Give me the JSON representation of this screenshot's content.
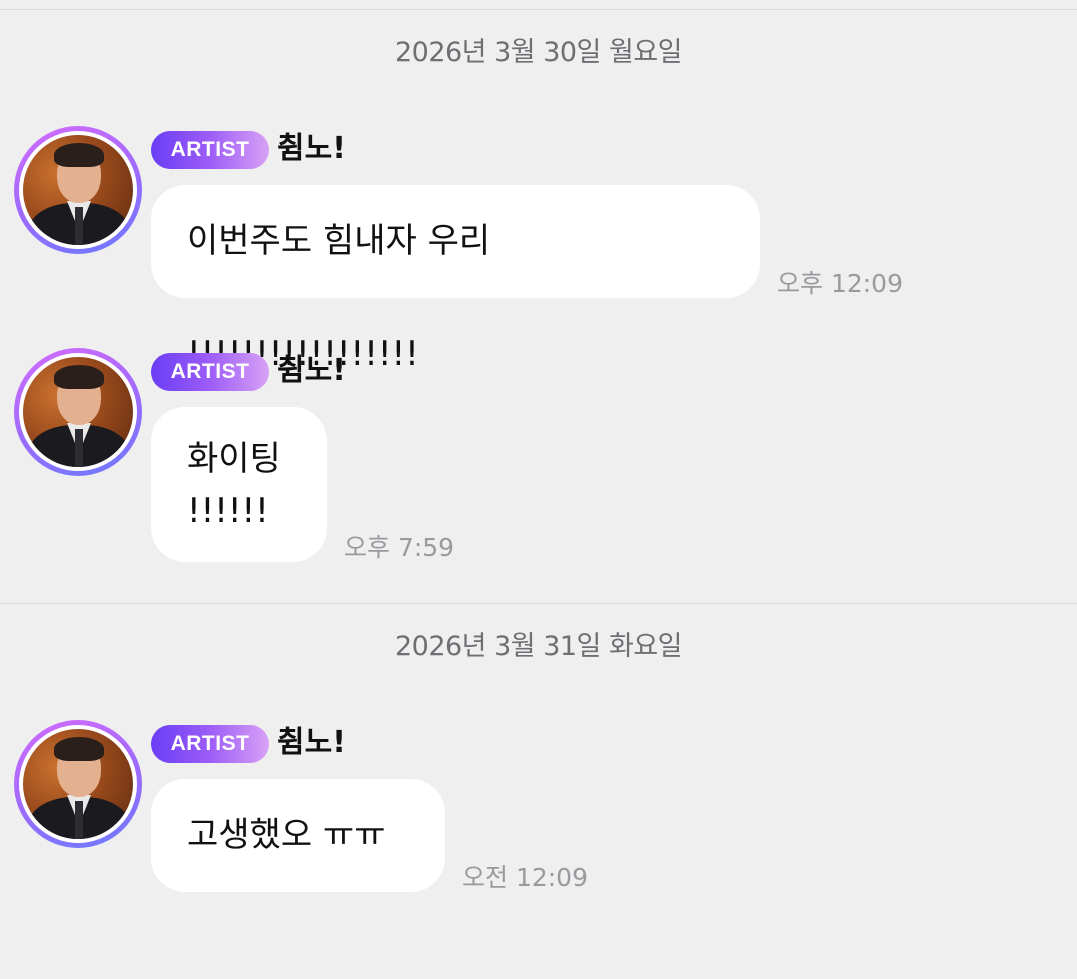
{
  "days": [
    {
      "date": "2026년 3월 30일 월요일",
      "messages": [
        {
          "badge": "ARTIST",
          "name": "췸노!",
          "text": "이번주도 힘내자 우리 !!!!!!!!!!!!!!!!!",
          "time": "오후 12:09"
        },
        {
          "badge": "ARTIST",
          "name": "췸노!",
          "text": "화이팅\n!!!!!!",
          "time": "오후 7:59"
        }
      ]
    },
    {
      "date": "2026년 3월 31일 화요일",
      "messages": [
        {
          "badge": "ARTIST",
          "name": "췸노!",
          "text": "고생했오 ㅠㅠ",
          "time": "오전 12:09"
        }
      ]
    }
  ],
  "colors": {
    "badge_gradient_start": "#6a3df5",
    "badge_gradient_end": "#d7a2f6",
    "background": "#efeff0",
    "bubble": "#ffffff"
  }
}
